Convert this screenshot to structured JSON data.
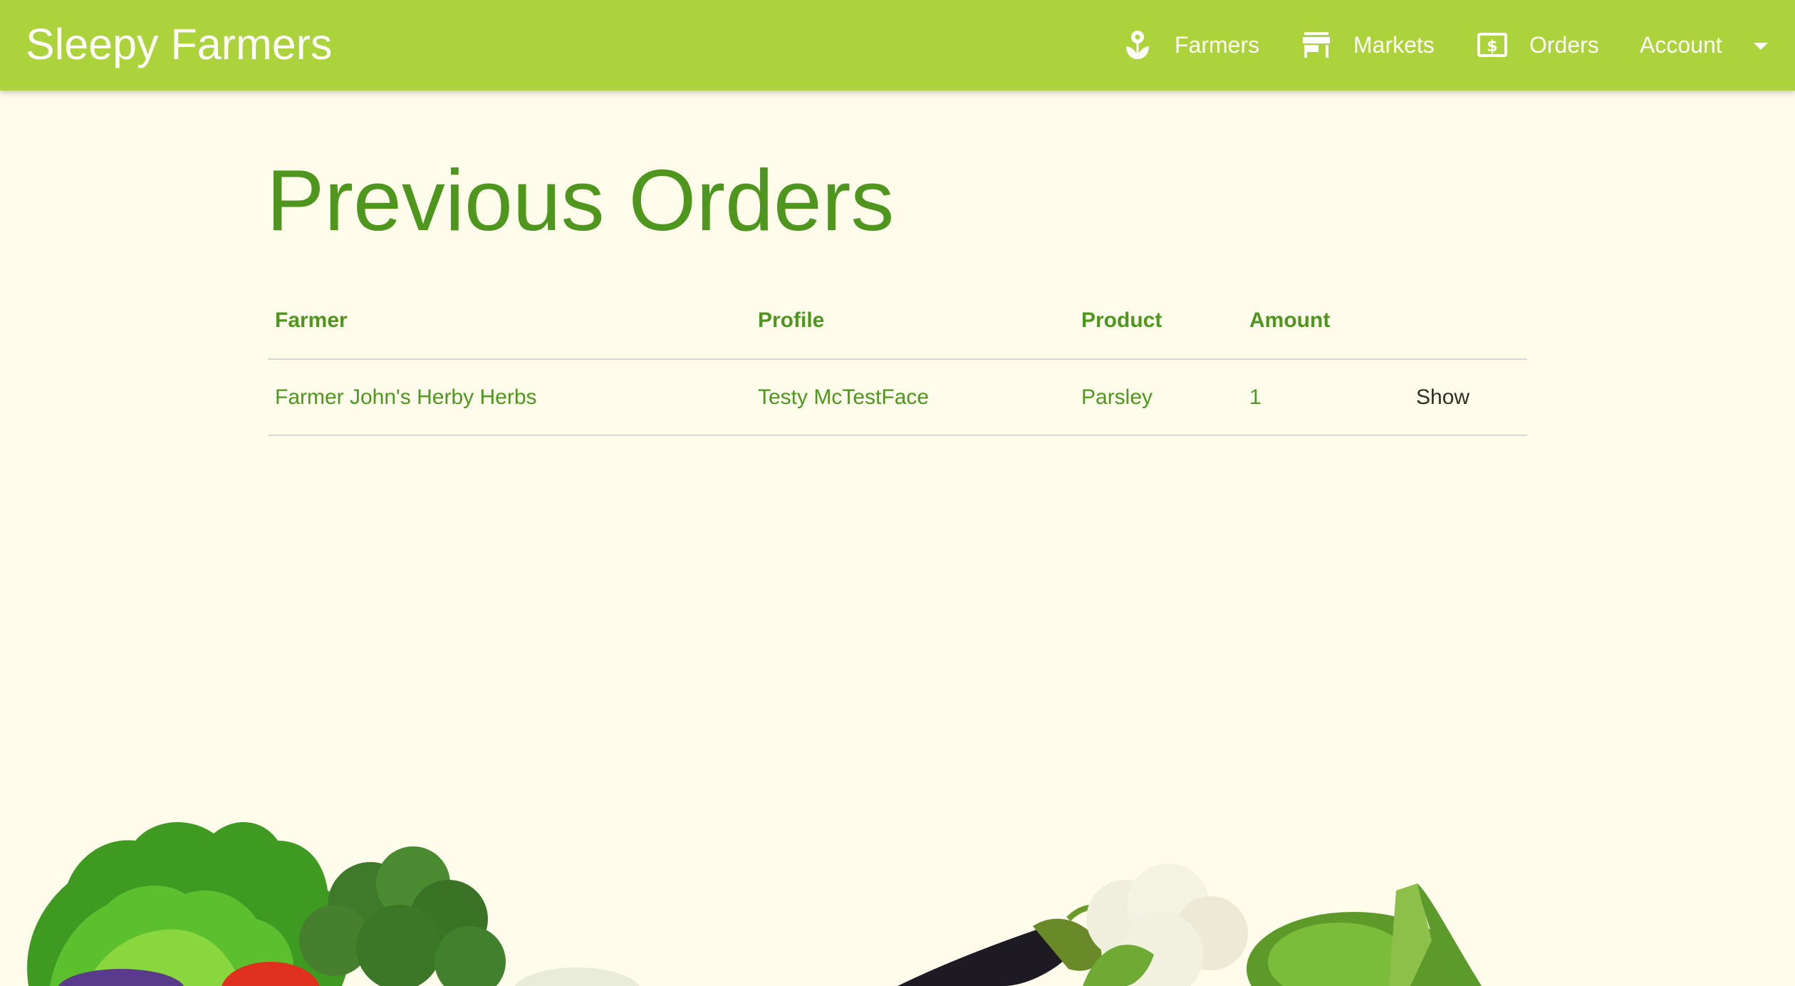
{
  "app": {
    "brand": "Sleepy Farmers",
    "accent_color": "#acd23c",
    "text_green": "#4f961e",
    "background_color": "#fffcec"
  },
  "nav": {
    "farmers": {
      "label": "Farmers",
      "icon": "seedling-flower-icon"
    },
    "markets": {
      "label": "Markets",
      "icon": "storefront-icon"
    },
    "orders": {
      "label": "Orders",
      "icon": "dollar-bill-icon"
    },
    "account": {
      "label": "Account",
      "icon": "caret-down-icon"
    }
  },
  "page": {
    "title": "Previous Orders"
  },
  "table": {
    "headers": {
      "farmer": "Farmer",
      "profile": "Profile",
      "product": "Product",
      "amount": "Amount"
    },
    "rows": [
      {
        "farmer": "Farmer John's Herby Herbs",
        "profile": "Testy McTestFace",
        "product": "Parsley",
        "amount": "1",
        "action": "Show"
      }
    ]
  },
  "footer_image": {
    "description_icon": "vegetables-illustration"
  }
}
